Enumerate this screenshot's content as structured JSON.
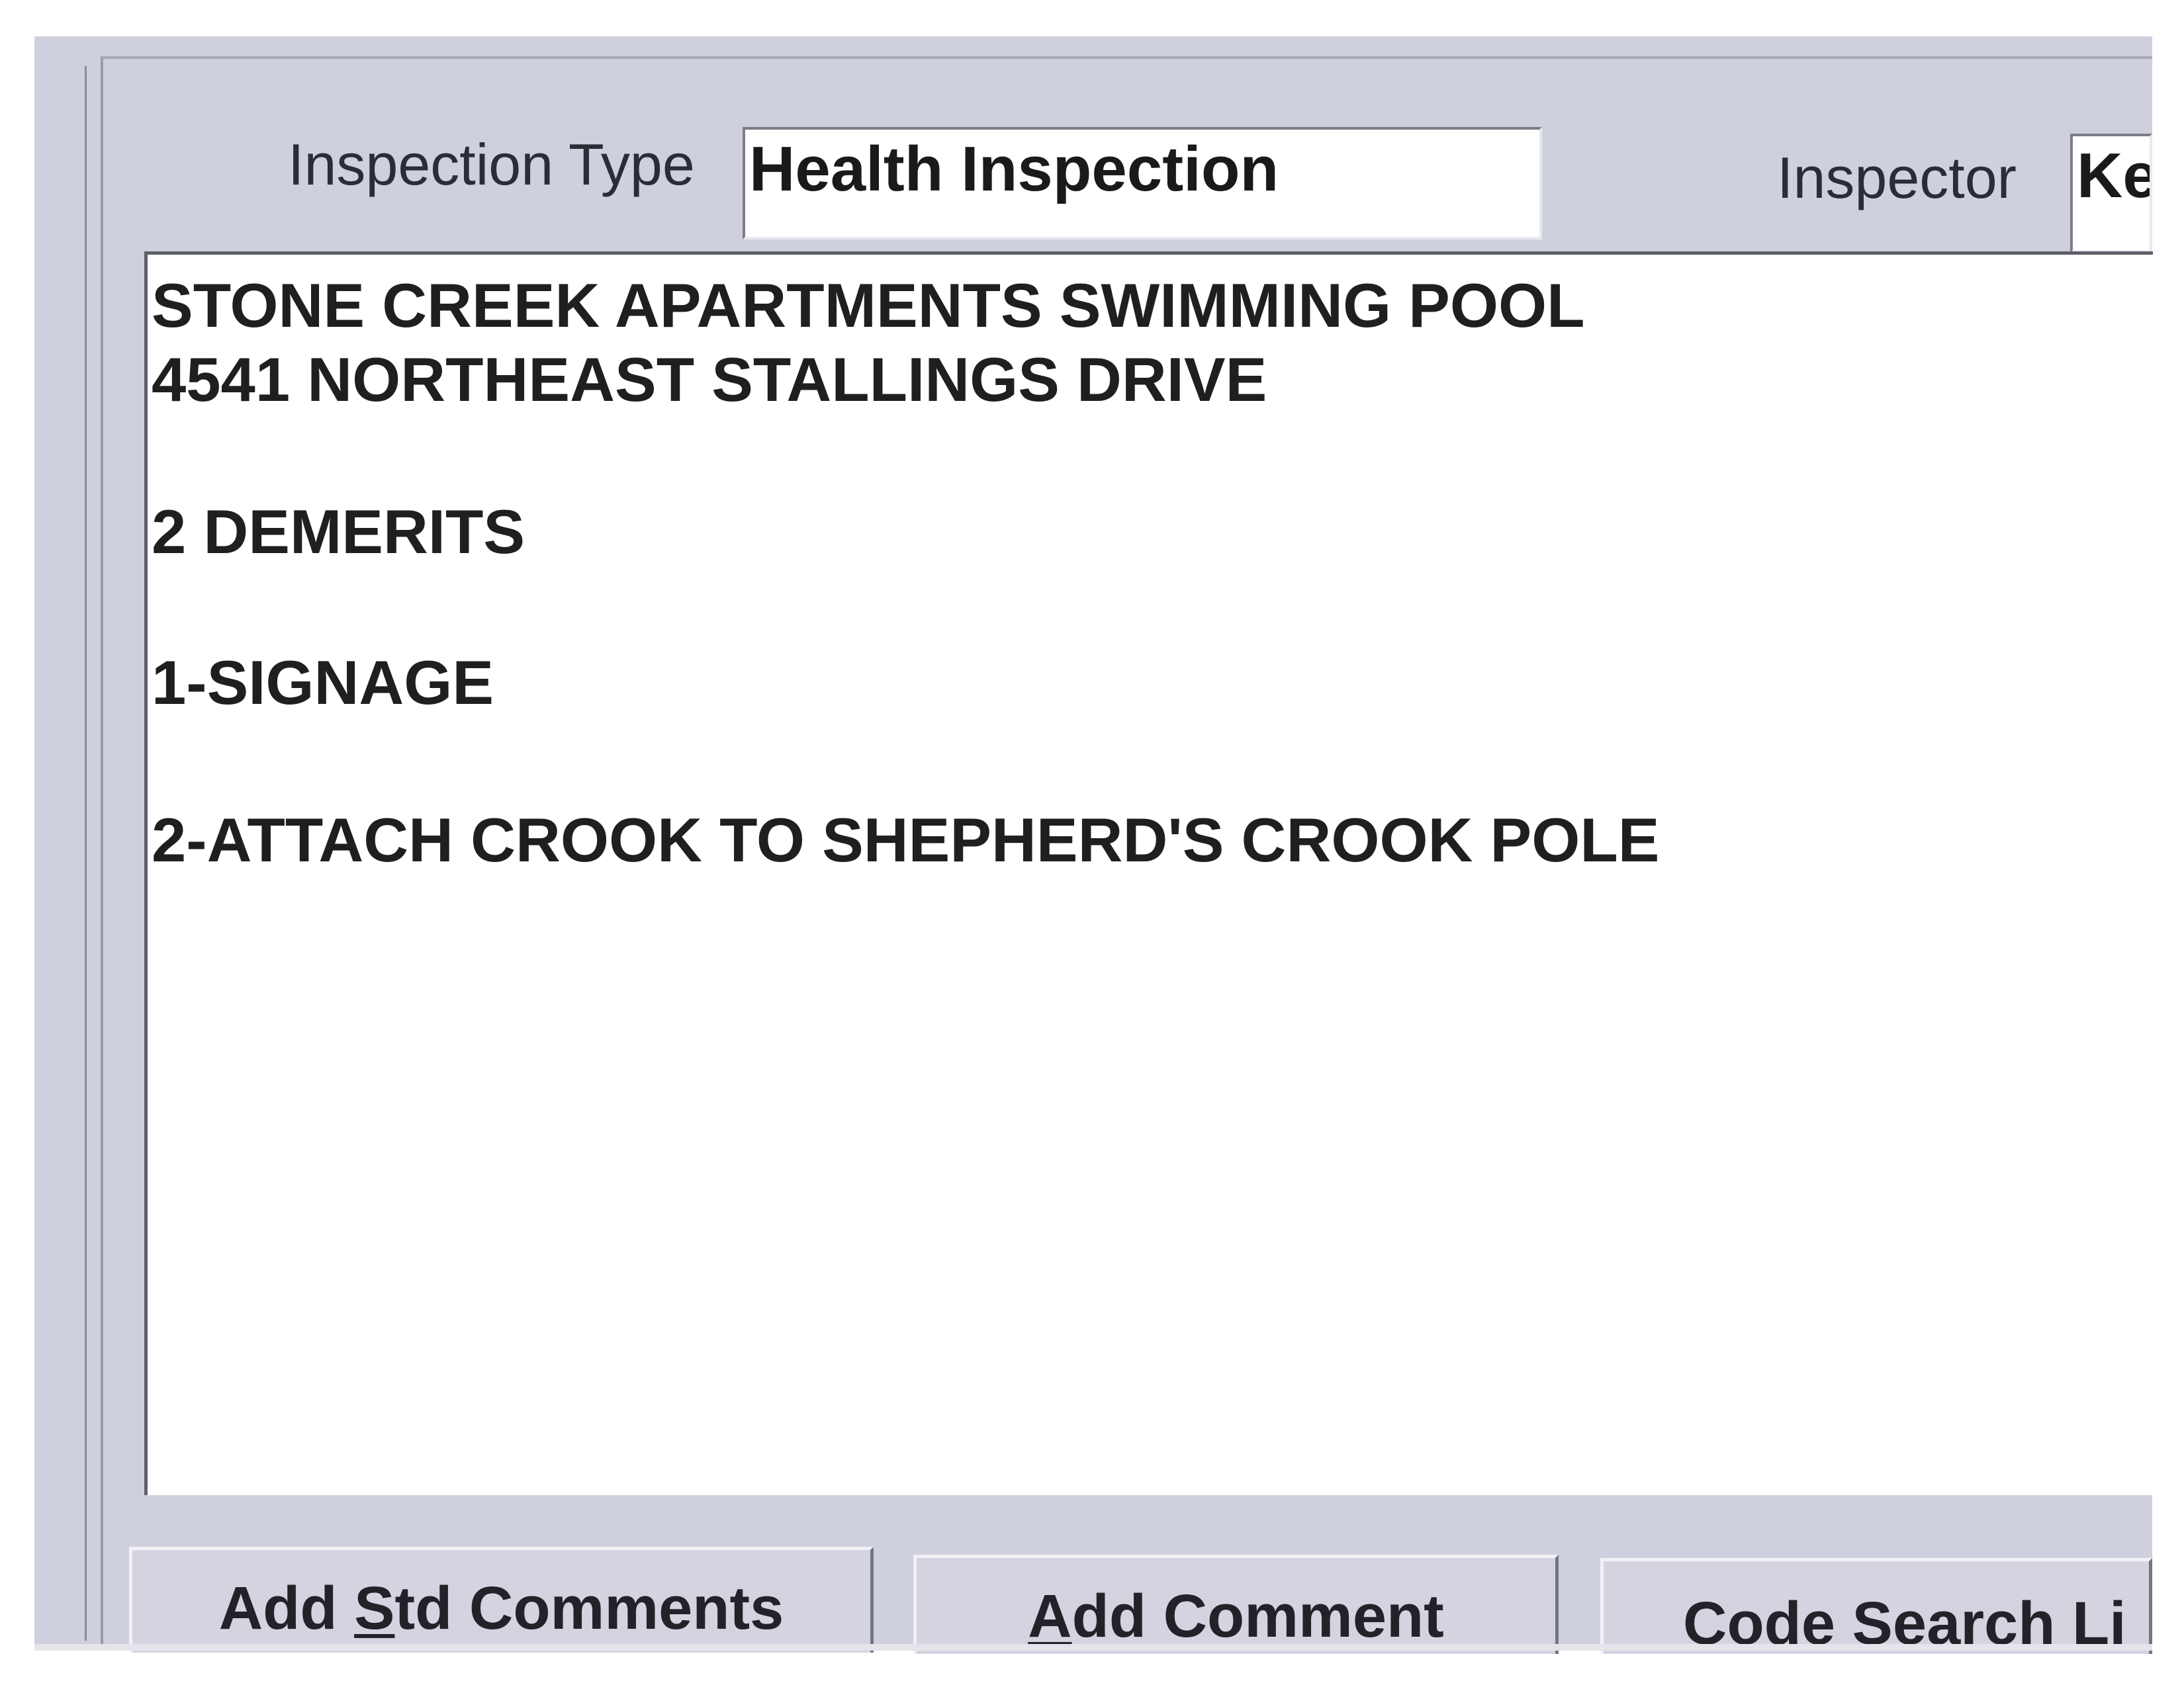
{
  "header": {
    "inspection_type_label": "Inspection Type",
    "inspection_type_value": "Health Inspection",
    "inspector_label": "Inspector",
    "inspector_value": "Ke"
  },
  "comments": {
    "lines": [
      "STONE CREEK APARTMENTS SWIMMING POOL",
      "4541 NORTHEAST STALLINGS DRIVE",
      "2 DEMERITS",
      "1-SIGNAGE",
      "2-ATTACH CROOK TO SHEPHERD'S CROOK POLE"
    ]
  },
  "buttons": {
    "add_std_comments": {
      "before": "Add ",
      "mnemonic": "S",
      "after": "td Comments"
    },
    "add_comment": {
      "before": "",
      "mnemonic": "A",
      "after": "dd Comment"
    },
    "code_search": {
      "label": "Code Search Li"
    }
  },
  "colors": {
    "panel": "#cfd0dd",
    "field_background": "#ffffff",
    "text": "#1f1f1f"
  }
}
